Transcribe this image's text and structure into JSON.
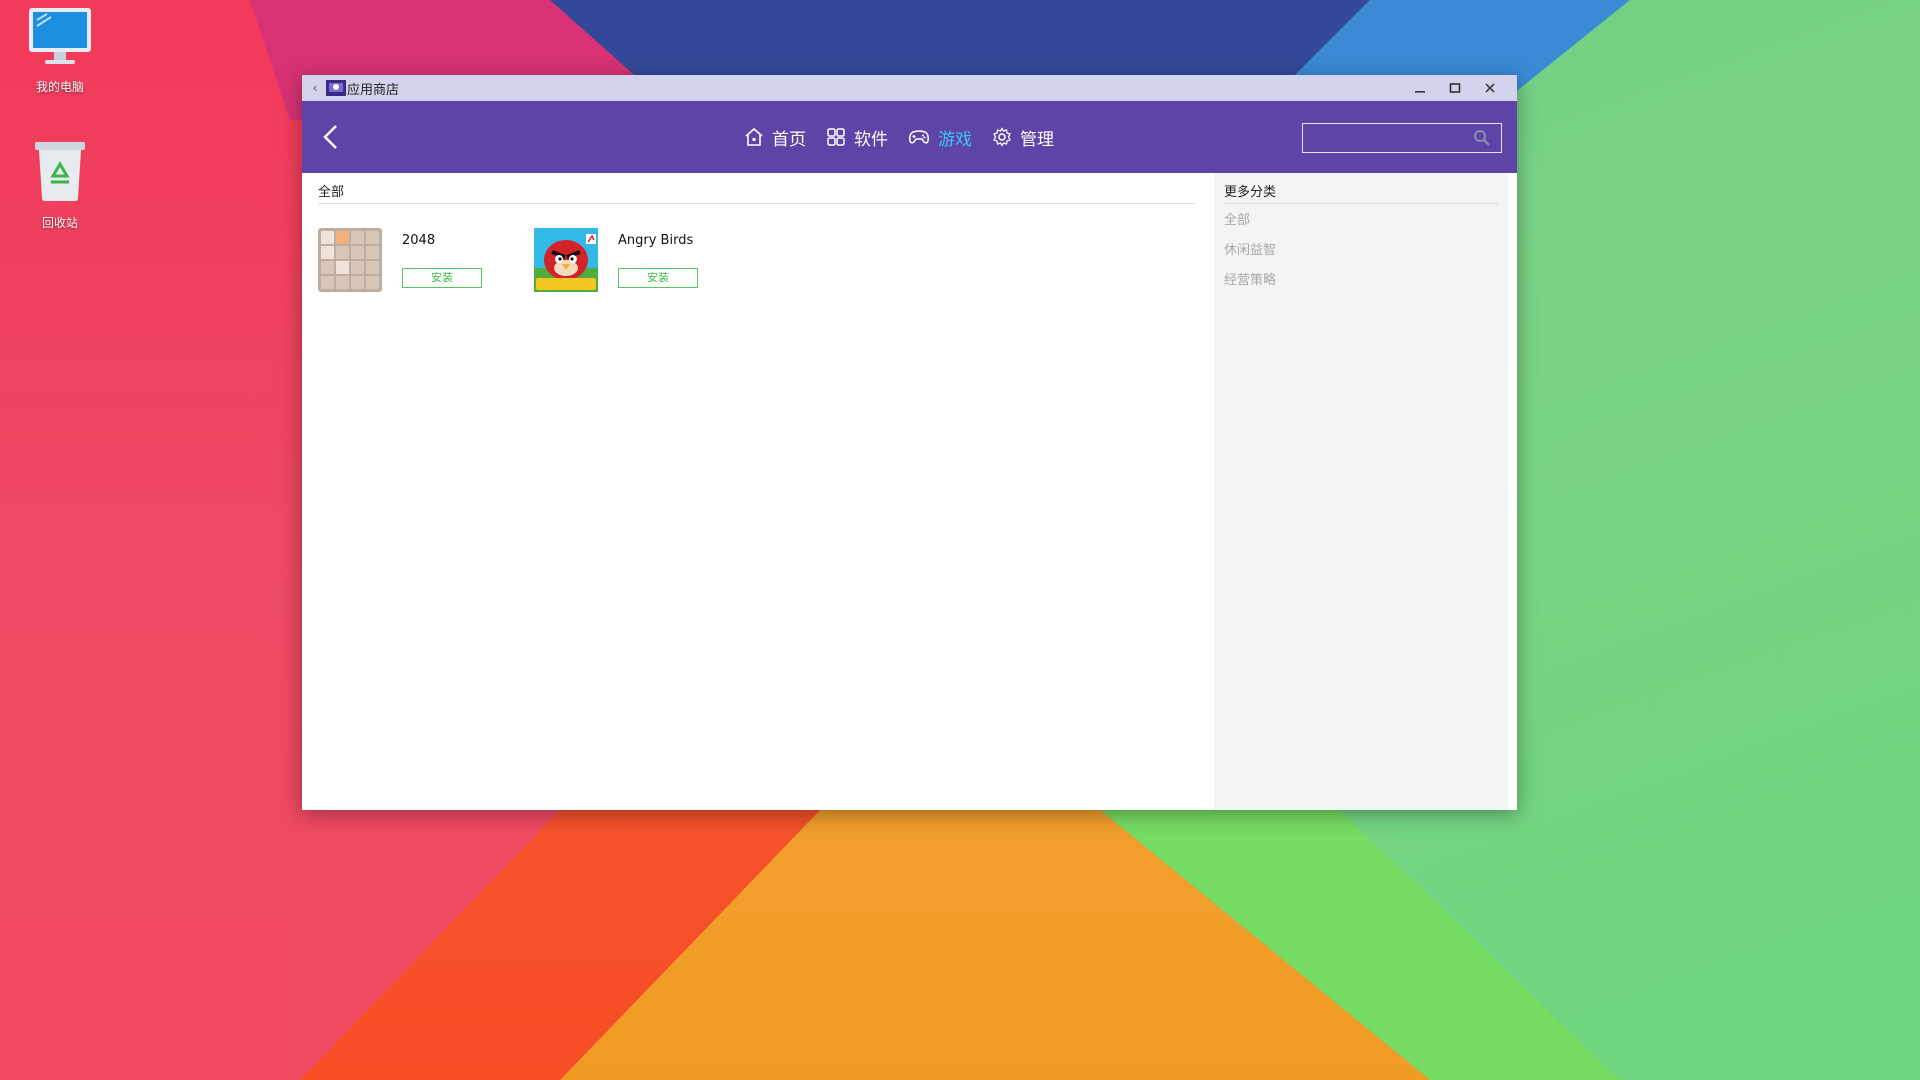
{
  "desktop": {
    "icons": [
      {
        "label": "我的电脑"
      },
      {
        "label": "回收站"
      }
    ]
  },
  "window": {
    "title": "应用商店",
    "controls": [
      "minimize-icon",
      "maximize-icon",
      "close-icon"
    ]
  },
  "nav": {
    "tabs": [
      {
        "label": "首页",
        "icon": "home-icon"
      },
      {
        "label": "软件",
        "icon": "grid-icon"
      },
      {
        "label": "游戏",
        "icon": "gamepad-icon",
        "active": true
      },
      {
        "label": "管理",
        "icon": "gear-icon"
      }
    ],
    "search": {
      "placeholder": "",
      "value": ""
    },
    "active_color": "#3fc2f6",
    "bar_color": "#5e44a7"
  },
  "main": {
    "section_title": "全部",
    "apps": [
      {
        "name": "2048",
        "install_label": "安装"
      },
      {
        "name": "Angry Birds",
        "install_label": "安装"
      }
    ]
  },
  "sidebar": {
    "title": "更多分类",
    "categories": [
      "全部",
      "休闲益智",
      "经营策略"
    ]
  }
}
